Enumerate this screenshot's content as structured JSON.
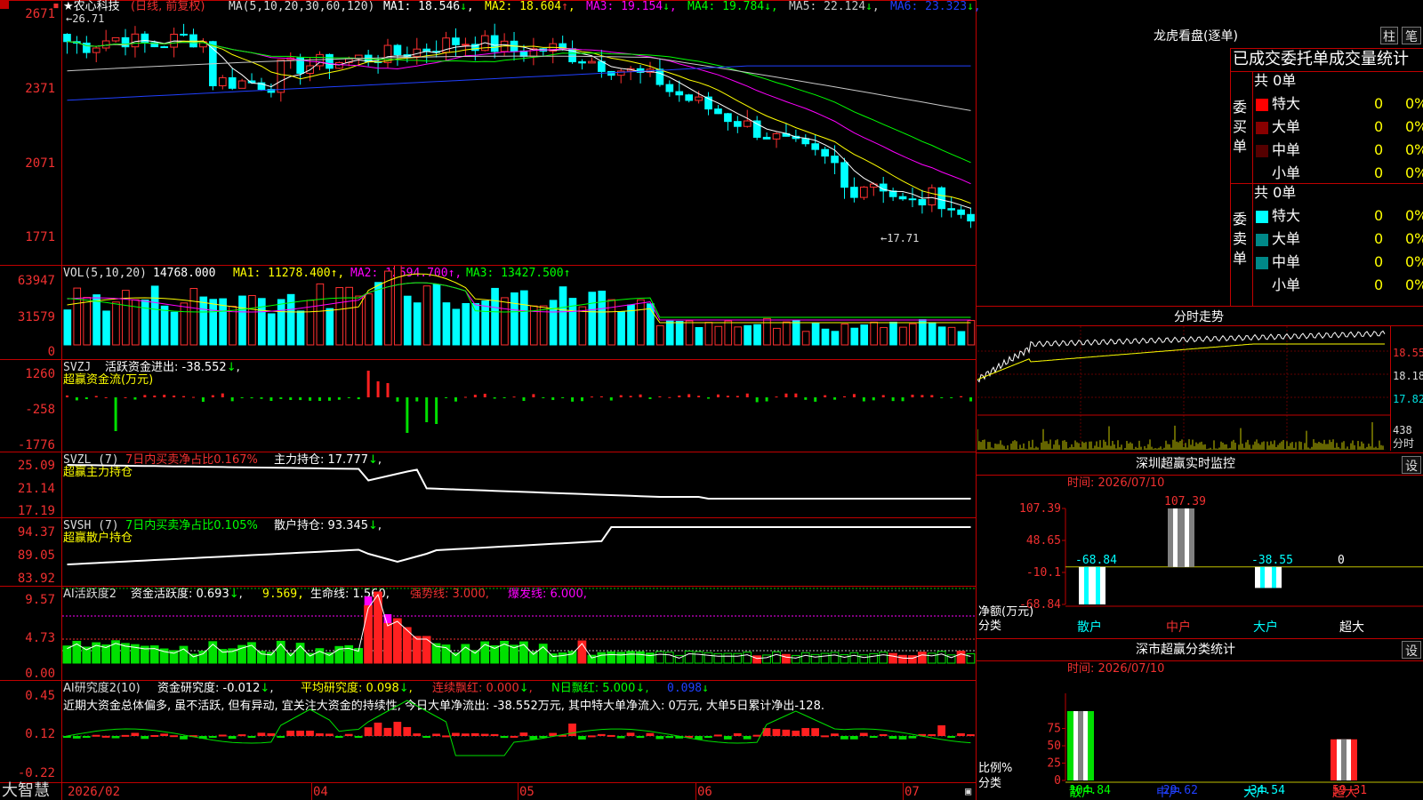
{
  "app": {
    "brand": "大智慧"
  },
  "kline": {
    "title": "★农心科技",
    "period": "(日线, 前复权)",
    "ma_label": "MA(5,10,20,30,60,120)",
    "ma": [
      {
        "label": "MA1:",
        "value": "18.546",
        "arrow": "↓",
        "color": "#ffffff"
      },
      {
        "label": "MA2:",
        "value": "18.604",
        "arrow": "↑",
        "color": "#ffff00"
      },
      {
        "label": "MA3:",
        "value": "19.154",
        "arrow": "↓",
        "color": "#ff00ff"
      },
      {
        "label": "MA4:",
        "value": "19.784",
        "arrow": "↓",
        "color": "#00ff00"
      },
      {
        "label": "MA5:",
        "value": "22.124",
        "arrow": "↓",
        "color": "#c8c8c8"
      },
      {
        "label": "MA6:",
        "value": "23.323",
        "arrow": "↓",
        "color": "#2040ff"
      }
    ],
    "yticks": [
      "2671",
      "2371",
      "2071",
      "1771"
    ],
    "high_mark": "←26.71",
    "low_mark": "←17.71",
    "price_high": 26.71,
    "price_low": 17.71
  },
  "vol": {
    "label": "VOL(5,10,20)",
    "value": "14768.000",
    "ma1": "11278.400",
    "ma2": "12594.700",
    "ma3": "13427.500",
    "yticks": [
      "63947",
      "31579",
      "0"
    ]
  },
  "svzj": {
    "label": "SVZJ",
    "desc": "活跃资金进出: -38.552",
    "subtitle": "超赢资金流(万元)",
    "yticks": [
      "1260",
      "-258",
      "-1776"
    ]
  },
  "svzl": {
    "label": "SVZL (7)",
    "desc": "7日内买卖净占比0.167%",
    "extra": "主力持仓: 17.777",
    "subtitle": "超赢主力持仓",
    "yticks": [
      "25.09",
      "21.14",
      "17.19"
    ]
  },
  "svsh": {
    "label": "SVSH (7)",
    "desc": "7日内买卖净占比0.105%",
    "extra": "散户持仓: 93.345",
    "subtitle": "超赢散户持仓",
    "yticks": [
      "94.37",
      "89.05",
      "83.92"
    ]
  },
  "ai1": {
    "label": "AI活跃度2",
    "a": "资金活跃度: 0.693",
    "b": "9.569,",
    "c": "生命线: 1.560,",
    "d": "强势线: 3.000,",
    "e": "爆发线: 6.000,",
    "yticks": [
      "9.57",
      "4.73",
      "0.00"
    ]
  },
  "ai2": {
    "label": "AI研究度2(10)",
    "a": "资金研究度: -0.012",
    "b": "平均研究度: 0.098",
    "c": "连续飘红: 0.000",
    "d": "N日飘红: 5.000",
    "e": "0.098",
    "note": "近期大资金总体偏多, 虽不活跃, 但有异动, 宜关注大资金的持续性, 今日大单净流出: -38.552万元, 其中特大单净流入: 0万元, 大单5日累计净出-128.",
    "yticks": [
      "0.45",
      "0.12",
      "-0.22"
    ]
  },
  "xaxis": [
    "2026/02",
    "04",
    "05",
    "06",
    "07"
  ],
  "longhu": {
    "title": "龙虎看盘(逐单)",
    "btn1": "柱",
    "btn2": "笔",
    "header": "已成交委托单成交量统计",
    "buy_label": "委买单",
    "sell_label": "委卖单",
    "buy_total": "共 0单",
    "sell_total": "共 0单",
    "rows": [
      {
        "name": "特大",
        "v": "0",
        "p": "0%"
      },
      {
        "name": "大单",
        "v": "0",
        "p": "0%"
      },
      {
        "name": "中单",
        "v": "0",
        "p": "0%"
      },
      {
        "name": "小单",
        "v": "0",
        "p": "0%"
      }
    ]
  },
  "fenshi": {
    "title": "分时走势",
    "p1": "18.55",
    "p2": "18.18",
    "p3": "17.82",
    "vol": "438",
    "vol_unit": "分时"
  },
  "sz_monitor": {
    "title": "深圳超赢实时监控",
    "set": "设",
    "time": "时间: 2026/07/10",
    "yticks": [
      "107.39",
      "48.65",
      "-10.1",
      "-68.84"
    ],
    "ylabel": "净额(万元)",
    "xlabel": "分类",
    "cats": [
      "散户",
      "中户",
      "大户",
      "超大"
    ],
    "bars": [
      {
        "cat": "散户",
        "value": -68.84
      },
      {
        "cat": "中户",
        "value": 107.39
      },
      {
        "cat": "大户",
        "value": -38.55
      },
      {
        "cat": "超大",
        "value": 0
      }
    ],
    "bar_labels": [
      "-68.84",
      "107.39",
      "-38.55",
      "0"
    ]
  },
  "sz_stats": {
    "title": "深市超赢分类统计",
    "set": "设",
    "time": "时间: 2026/07/10",
    "yticks": [
      "75",
      "50",
      "25",
      "0"
    ],
    "ylabel": "比例%",
    "xlabel": "分类",
    "cats": [
      "散户",
      "中户",
      "大户",
      "超大"
    ],
    "bar_labels": [
      "104.84",
      "-29.62",
      "-34.54",
      "59.31"
    ],
    "bars": [
      {
        "cat": "散户",
        "value": 104.84
      },
      {
        "cat": "中户",
        "value": -29.62
      },
      {
        "cat": "大户",
        "value": -34.54
      },
      {
        "cat": "超大",
        "value": 59.31
      }
    ]
  }
}
